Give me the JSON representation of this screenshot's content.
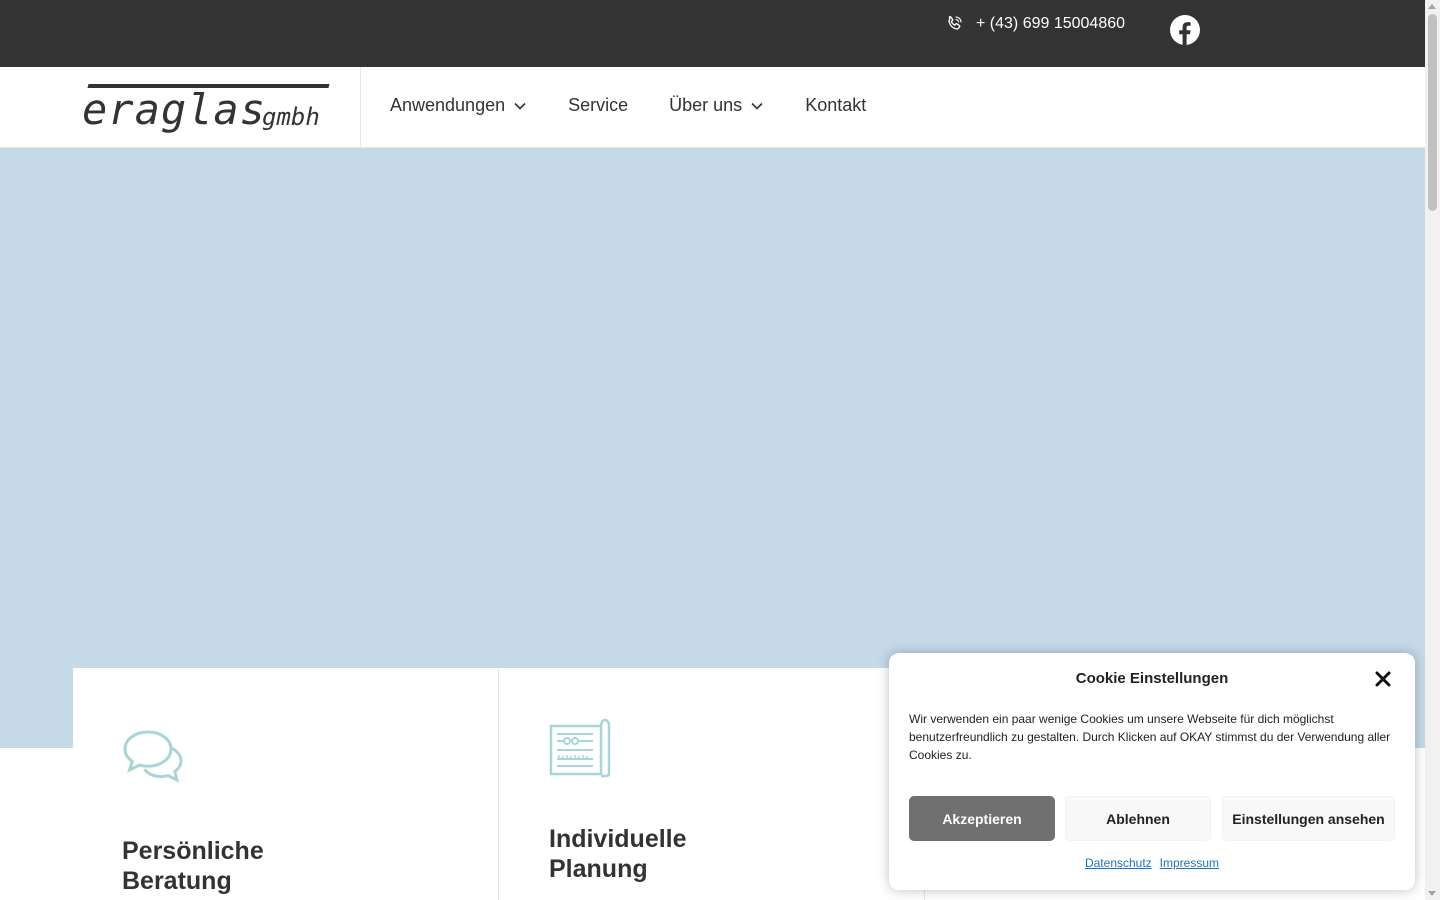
{
  "topbar": {
    "phone": "+ (43) 699 15004860",
    "phone_icon": "phone-icon",
    "social_icon": "facebook-icon"
  },
  "header": {
    "logo_word": "eraglas",
    "logo_sub": "gmbh",
    "nav": [
      {
        "label": "Anwendungen",
        "has_dropdown": true
      },
      {
        "label": "Service",
        "has_dropdown": false
      },
      {
        "label": "Über uns",
        "has_dropdown": true
      },
      {
        "label": "Kontakt",
        "has_dropdown": false
      }
    ]
  },
  "hero": {
    "background": "#c5d9e7"
  },
  "cards": [
    {
      "title": "Persönliche\nBeratung",
      "icon": "chat-bubbles-icon"
    },
    {
      "title": "Individuelle\nPlanung",
      "icon": "blueprint-icon"
    }
  ],
  "cookie": {
    "title": "Cookie Einstellungen",
    "text": "Wir verwenden ein paar wenige Cookies um unsere Webseite für dich möglichst benutzerfreundlich zu gestalten. Durch Klicken auf OKAY stimmst du der Verwendung aller Cookies zu.",
    "accept": "Akzeptieren",
    "deny": "Ablehnen",
    "prefs": "Einstellungen ansehen",
    "link_privacy": "Datenschutz",
    "link_imprint": "Impressum"
  },
  "colors": {
    "topbar": "#333333",
    "accent_icon": "#a8d5d8",
    "accept_button": "#707070",
    "link": "#1e73be"
  }
}
